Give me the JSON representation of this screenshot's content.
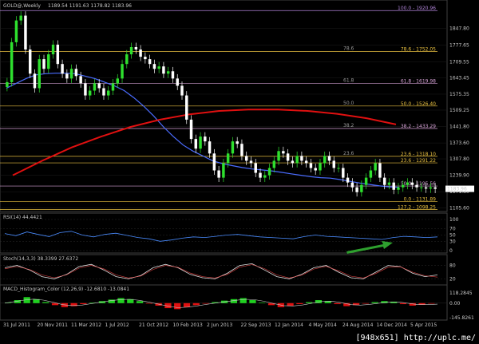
{
  "chart_data": [
    {
      "type": "candlestick",
      "title": "GOLD@,Weekly",
      "ohlc_header": "1189.54 1191.63 1178.82 1183.96",
      "ylim": [
        1100,
        1925
      ],
      "price_ticks": [
        1847.8,
        1777.65,
        1709.55,
        1643.45,
        1575.35,
        1509.25,
        1441.8,
        1373.6,
        1307.8,
        1239.9,
        1171.8,
        1105.6
      ],
      "current_price": "1183.96",
      "x_labels": [
        "31 Jul 2011",
        "20 Nov 2011",
        "11 Mar 2012",
        "1 Jul 2012",
        "21 Oct 2012",
        "10 Feb 2013",
        "2 Jun 2013",
        "22 Sep 2013",
        "12 Jan 2014",
        "4 May 2014",
        "24 Aug 2014",
        "14 Dec 2014",
        "5 Apr 2015"
      ],
      "series": [
        {
          "name": "weekly-close",
          "values": [
            1625,
            1790,
            1880,
            1900,
            1760,
            1660,
            1600,
            1720,
            1680,
            1740,
            1780,
            1700,
            1660,
            1640,
            1680,
            1650,
            1620,
            1570,
            1590,
            1620,
            1600,
            1570,
            1590,
            1620,
            1640,
            1700,
            1740,
            1770,
            1760,
            1730,
            1720,
            1700,
            1680,
            1690,
            1660,
            1670,
            1640,
            1610,
            1570,
            1470,
            1390,
            1350,
            1400,
            1380,
            1330,
            1260,
            1230,
            1290,
            1330,
            1380,
            1370,
            1320,
            1300,
            1290,
            1250,
            1230,
            1240,
            1270,
            1300,
            1340,
            1330,
            1300,
            1290,
            1320,
            1300,
            1290,
            1270,
            1260,
            1290,
            1320,
            1300,
            1270,
            1270,
            1230,
            1210,
            1190,
            1170,
            1200,
            1230,
            1260,
            1290,
            1230,
            1200,
            1210,
            1180,
            1190,
            1200,
            1210,
            1200,
            1190,
            1190,
            1185,
            1190,
            1184
          ]
        },
        {
          "name": "MA-50",
          "values": [
            1600,
            1620,
            1640,
            1655,
            1660,
            1662,
            1662,
            1660,
            1650,
            1640,
            1625,
            1610,
            1590,
            1560,
            1525,
            1485,
            1440,
            1400,
            1365,
            1340,
            1320,
            1300,
            1288,
            1280,
            1272,
            1266,
            1262,
            1258,
            1252,
            1246,
            1240,
            1234,
            1230,
            1228,
            1222,
            1215,
            1208,
            1202,
            1196,
            1192,
            1190
          ]
        },
        {
          "name": "MA-200",
          "values": [
            1240,
            1300,
            1355,
            1400,
            1440,
            1470,
            1492,
            1506,
            1512,
            1512,
            1506,
            1494,
            1476,
            1450
          ]
        }
      ],
      "levels": [
        {
          "label": "100.0 - 1920.96",
          "value": 1920.96,
          "color": "#b084d8"
        },
        {
          "label": "78.6 - 1752.05",
          "value": 1752.05,
          "color": "#e8c040"
        },
        {
          "label": "61.8 - 1619.98",
          "value": 1619.98,
          "color": "#d4a0d4"
        },
        {
          "label": "50.0 - 1526.40",
          "value": 1526.4,
          "color": "#e8c040"
        },
        {
          "label": "38.2 - 1433.29",
          "value": 1433.29,
          "color": "#d4a0d4"
        },
        {
          "label": "23.6 - 1318.10",
          "value": 1318.1,
          "color": "#e8c040"
        },
        {
          "label": "23.6 - 1291.22",
          "value": 1291.22,
          "color": "#e8c040"
        },
        {
          "label": "50.0 - 1195.56",
          "value": 1195.56,
          "color": "#d4a0d4"
        },
        {
          "label": "0.0 - 1131.89",
          "value": 1131.89,
          "color": "#e8c040"
        },
        {
          "label": "127.2 - 1098.25",
          "value": 1098.25,
          "color": "#e8c040"
        }
      ],
      "level_marks": [
        "78.6",
        "61.8",
        "50.0",
        "38.2",
        "23.6"
      ]
    },
    {
      "type": "line",
      "title": "RSI(14) 44.4421",
      "ylim": [
        0,
        100
      ],
      "ticks": [
        100,
        70,
        50,
        30,
        0
      ],
      "series": [
        {
          "name": "RSI",
          "values": [
            55,
            48,
            60,
            52,
            45,
            58,
            62,
            50,
            44,
            52,
            56,
            49,
            42,
            38,
            30,
            34,
            40,
            44,
            42,
            46,
            50,
            52,
            48,
            44,
            42,
            40,
            38,
            45,
            50,
            46,
            44,
            42,
            40,
            38,
            36,
            42,
            46,
            44,
            42,
            44
          ]
        }
      ]
    },
    {
      "type": "line",
      "title": "Stoch(14,3,3) 38.3399 27.6372",
      "ylim": [
        0,
        100
      ],
      "ticks": [
        80,
        20
      ],
      "series": [
        {
          "name": "K",
          "values": [
            70,
            80,
            60,
            30,
            20,
            40,
            75,
            85,
            60,
            30,
            20,
            35,
            70,
            85,
            70,
            40,
            25,
            20,
            45,
            80,
            88,
            60,
            30,
            20,
            40,
            70,
            80,
            50,
            25,
            20,
            50,
            80,
            75,
            45,
            30,
            38
          ]
        },
        {
          "name": "D",
          "values": [
            65,
            75,
            62,
            38,
            25,
            38,
            68,
            80,
            65,
            38,
            24,
            32,
            62,
            80,
            72,
            46,
            30,
            24,
            40,
            72,
            84,
            66,
            38,
            24,
            36,
            64,
            76,
            56,
            32,
            24,
            44,
            72,
            74,
            50,
            34,
            28
          ]
        }
      ]
    },
    {
      "type": "bar",
      "title": "MACD_Histogram_Color (12,26,9) -12.6810 -13.0841",
      "ylim": [
        -145,
        118
      ],
      "ticks": [
        "118.2845",
        "0.00",
        "-145.8261"
      ],
      "series": [
        {
          "name": "histogram",
          "values": [
            5,
            30,
            60,
            40,
            10,
            -20,
            -40,
            -30,
            -10,
            5,
            20,
            35,
            50,
            40,
            20,
            -5,
            -25,
            -50,
            -60,
            -40,
            -20,
            -5,
            10,
            25,
            40,
            50,
            30,
            5,
            -20,
            -40,
            -30,
            -10,
            10,
            30,
            20,
            -10,
            -30,
            -20,
            -5,
            10,
            20,
            15,
            -10,
            -25,
            -15,
            -5
          ]
        },
        {
          "name": "signal",
          "values": [
            0,
            15,
            30,
            40,
            30,
            10,
            -15,
            -25,
            -20,
            -5,
            10,
            25,
            35,
            38,
            28,
            10,
            -10,
            -30,
            -45,
            -40,
            -28,
            -12,
            2,
            15,
            28,
            38,
            34,
            18,
            -5,
            -25,
            -28,
            -18,
            0,
            18,
            20,
            5,
            -15,
            -20,
            -12,
            0,
            12,
            12,
            -2,
            -15,
            -15,
            -10
          ]
        }
      ]
    }
  ],
  "watermark": "[948x651] http://uplc.me/"
}
